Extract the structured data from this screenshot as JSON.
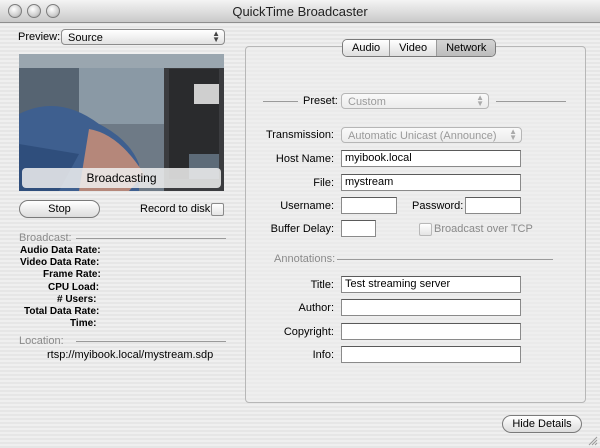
{
  "window": {
    "title": "QuickTime Broadcaster"
  },
  "preview": {
    "label": "Preview:",
    "source": "Source",
    "overlay": "Broadcasting"
  },
  "controls": {
    "stop_label": "Stop",
    "record_label": "Record to disk",
    "hide_details_label": "Hide Details"
  },
  "broadcast": {
    "heading": "Broadcast:",
    "stats": [
      "Audio Data Rate:",
      "Video Data Rate:",
      "Frame Rate:",
      "CPU Load:",
      "# Users:",
      "Total Data Rate:",
      "Time:"
    ]
  },
  "location": {
    "heading": "Location:",
    "url": "rtsp://myibook.local/mystream.sdp"
  },
  "tabs": [
    {
      "label": "Audio",
      "selected": false
    },
    {
      "label": "Video",
      "selected": false
    },
    {
      "label": "Network",
      "selected": true
    }
  ],
  "network": {
    "preset_label": "Preset:",
    "preset_value": "Custom",
    "transmission_label": "Transmission:",
    "transmission_value": "Automatic Unicast (Announce)",
    "host_label": "Host Name:",
    "host_value": "myibook.local",
    "file_label": "File:",
    "file_value": "mystream",
    "username_label": "Username:",
    "username_value": "",
    "password_label": "Password:",
    "password_value": "",
    "buffer_label": "Buffer Delay:",
    "buffer_value": "",
    "tcp_label": "Broadcast over TCP",
    "annotations_heading": "Annotations:",
    "title_label": "Title:",
    "title_value": "Test streaming server",
    "author_label": "Author:",
    "author_value": "",
    "copyright_label": "Copyright:",
    "copyright_value": "",
    "info_label": "Info:",
    "info_value": ""
  }
}
